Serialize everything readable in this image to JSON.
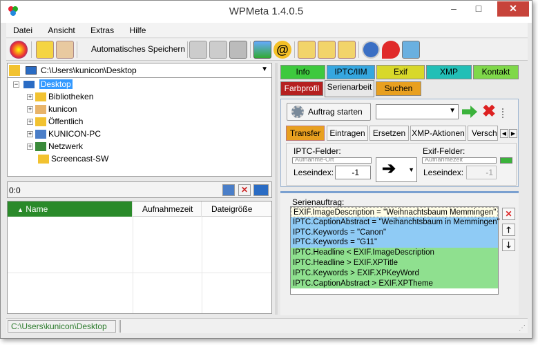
{
  "window": {
    "title": "WPMeta 1.4.0.5",
    "minimize_label": "–",
    "maximize_label": "□",
    "close_label": "✕"
  },
  "menu": {
    "items": [
      "Datei",
      "Ansicht",
      "Extras",
      "Hilfe"
    ]
  },
  "toolbar": {
    "autosave_label": "Automatisches Speichern"
  },
  "path": {
    "value": "C:\\Users\\kunicon\\Desktop"
  },
  "tree": {
    "root": "Desktop",
    "items": [
      "Bibliotheken",
      "kunicon",
      "Öffentlich",
      "KUNICON-PC",
      "Netzwerk",
      "Screencast-SW"
    ]
  },
  "files": {
    "count": "0:0",
    "columns": [
      "Name",
      "Aufnahmezeit",
      "Dateigröße"
    ]
  },
  "status": {
    "path": "C:\\Users\\kunicon\\Desktop"
  },
  "tabs_row1": [
    {
      "label": "Info",
      "color": "#3ec93e"
    },
    {
      "label": "IPTC/IIM",
      "color": "#35a7e0"
    },
    {
      "label": "Exif",
      "color": "#d8d82a"
    },
    {
      "label": "XMP",
      "color": "#22bfb6"
    },
    {
      "label": "Kontakt",
      "color": "#7fd84a"
    }
  ],
  "tabs_row2": [
    {
      "label": "Farbprofil",
      "color": "#b52020"
    },
    {
      "label": "Serienarbeit",
      "color": "#e8e8e8"
    },
    {
      "label": "Suchen",
      "color": "#e8a020"
    }
  ],
  "serie": {
    "start_label": "Auftrag starten",
    "subtabs": [
      "Transfer",
      "Eintragen",
      "Ersetzen",
      "XMP-Aktionen",
      "Versch"
    ],
    "iptc_label": "IPTC-Felder:",
    "iptc_value": "Aufnahme-Ort",
    "exif_label": "Exif-Felder:",
    "exif_value": "Aufnahmezeit",
    "read_index_label": "Leseindex:",
    "read_index_left": "-1",
    "read_index_right": "-1",
    "job_label": "Serienauftrag:",
    "jobs": [
      {
        "text": "EXIF.ImageDescription = \"Weihnachtsbaum Memmingen\"",
        "color": "#fffde6"
      },
      {
        "text": "IPTC.CaptionAbstract = \"Weihanchtsbaum in Memmingen\"",
        "color": "#8fcbf5"
      },
      {
        "text": "IPTC.Keywords = \"Canon\"",
        "color": "#8fcbf5"
      },
      {
        "text": "IPTC.Keywords = \"G11\"",
        "color": "#8fcbf5"
      },
      {
        "text": "IPTC.Headline < EXIF.ImageDescription",
        "color": "#8fe08f"
      },
      {
        "text": "IPTC.Headline > EXIF.XPTitle",
        "color": "#8fe08f"
      },
      {
        "text": "IPTC.Keywords > EXIF.XPKeyWord",
        "color": "#8fe08f"
      },
      {
        "text": "IPTC.CaptionAbstract > EXIF.XPTheme",
        "color": "#8fe08f"
      }
    ]
  }
}
